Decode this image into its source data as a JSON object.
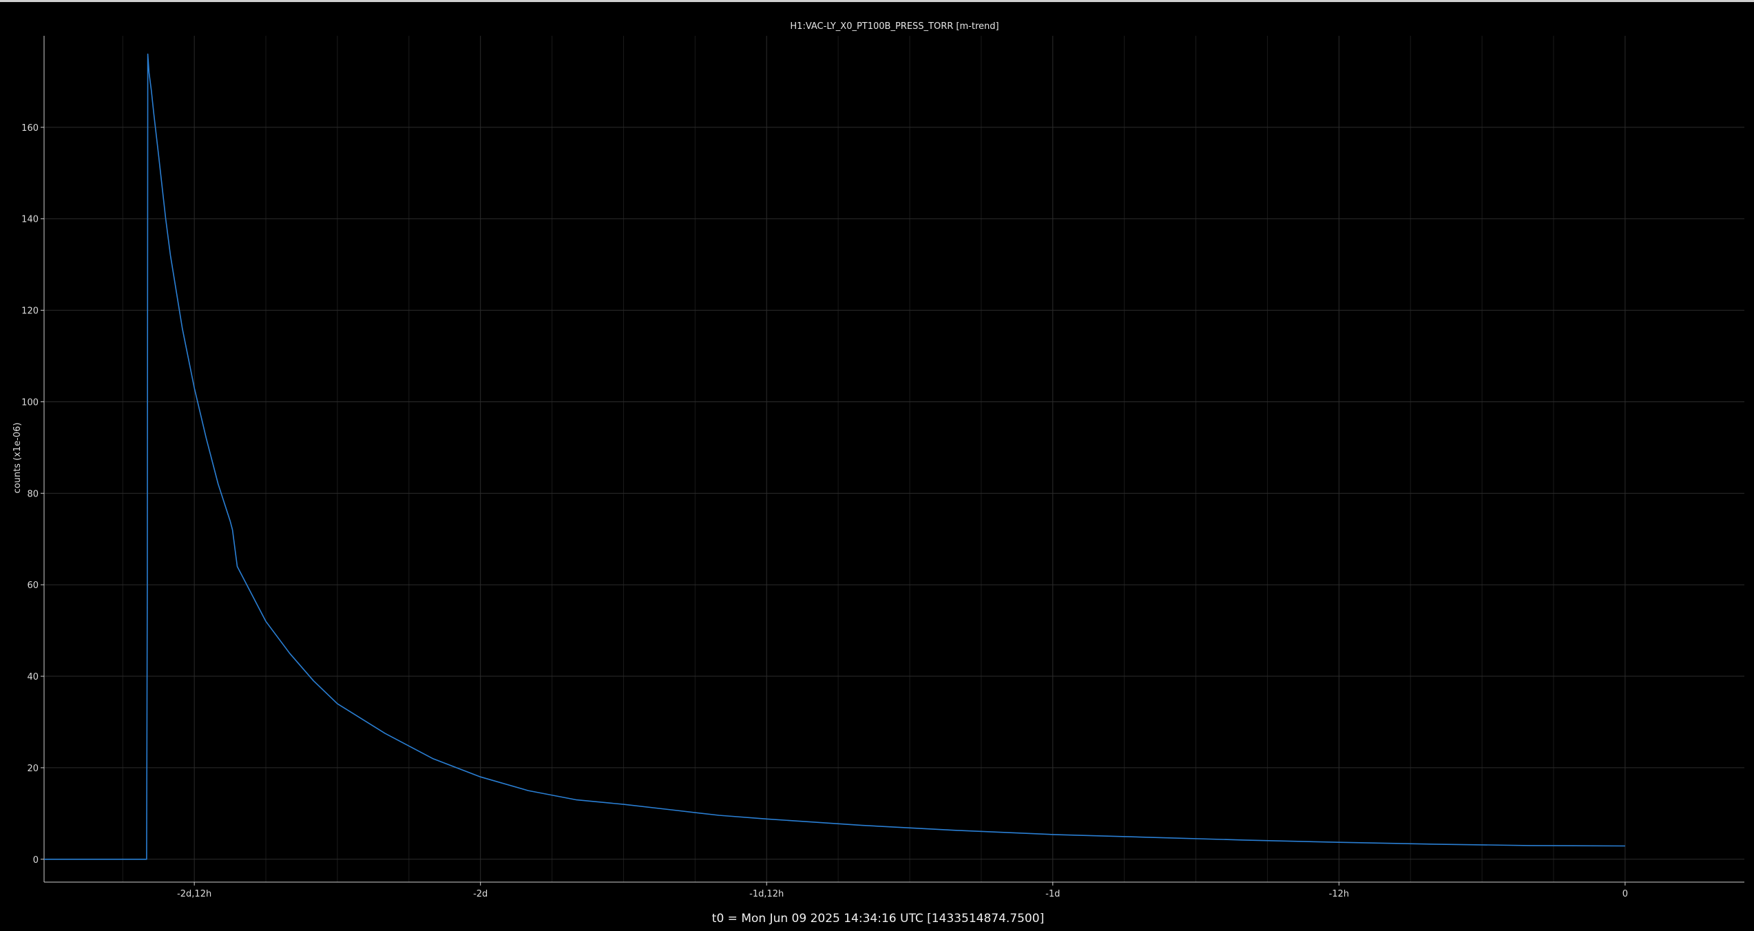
{
  "chart_data": {
    "type": "line",
    "title": "H1:VAC-LY_X0_PT100B_PRESS_TORR [m-trend]",
    "xlabel": "t0 = Mon Jun 09 2025 14:34:16 UTC [1433514874.7500]",
    "ylabel": "counts (x1e-06)",
    "x_unit": "hours relative to t0",
    "xlim": [
      -66.3,
      5.0
    ],
    "ylim": [
      -5,
      180
    ],
    "grid": true,
    "x_ticks": [
      {
        "value": -60,
        "label": "-2d,12h"
      },
      {
        "value": -48,
        "label": "-2d"
      },
      {
        "value": -36,
        "label": "-1d,12h"
      },
      {
        "value": -24,
        "label": "-1d"
      },
      {
        "value": -12,
        "label": "-12h"
      },
      {
        "value": 0,
        "label": "0"
      }
    ],
    "x_minor_ticks": [
      -63,
      -57,
      -54,
      -51,
      -45,
      -42,
      -39,
      -33,
      -30,
      -27,
      -21,
      -18,
      -15,
      -9,
      -6,
      -3
    ],
    "y_ticks": [
      {
        "value": 0,
        "label": "0"
      },
      {
        "value": 20,
        "label": "20"
      },
      {
        "value": 40,
        "label": "40"
      },
      {
        "value": 60,
        "label": "60"
      },
      {
        "value": 80,
        "label": "80"
      },
      {
        "value": 100,
        "label": "100"
      },
      {
        "value": 120,
        "label": "120"
      },
      {
        "value": 140,
        "label": "140"
      },
      {
        "value": 160,
        "label": "160"
      }
    ],
    "series": [
      {
        "color": "#2a7fd4",
        "x": [
          -66.3,
          -62.0,
          -61.97,
          -61.95,
          -61.9,
          -61.85,
          -61.8,
          -61.7,
          -61.5,
          -61.2,
          -61.0,
          -60.5,
          -60.0,
          -59.5,
          -59.0,
          -58.5,
          -58.4,
          -58.2,
          -58.0,
          -57.5,
          -57.0,
          -56.0,
          -55.0,
          -54.0,
          -52.0,
          -50.0,
          -48.0,
          -46.0,
          -44.0,
          -42.0,
          -40.0,
          -38.0,
          -36.0,
          -32.0,
          -28.0,
          -24.0,
          -20.0,
          -16.0,
          -12.0,
          -8.0,
          -4.0,
          0.0
        ],
        "y": [
          0,
          0,
          60,
          176,
          172,
          170,
          168,
          163,
          154,
          140,
          132,
          116,
          103,
          92,
          82,
          74,
          72,
          64,
          62,
          57,
          52,
          45,
          39,
          34,
          27.5,
          22,
          18,
          15,
          13,
          12,
          10.8,
          9.6,
          8.8,
          7.4,
          6.3,
          5.4,
          4.8,
          4.2,
          3.7,
          3.3,
          3.0,
          2.9
        ]
      }
    ]
  }
}
